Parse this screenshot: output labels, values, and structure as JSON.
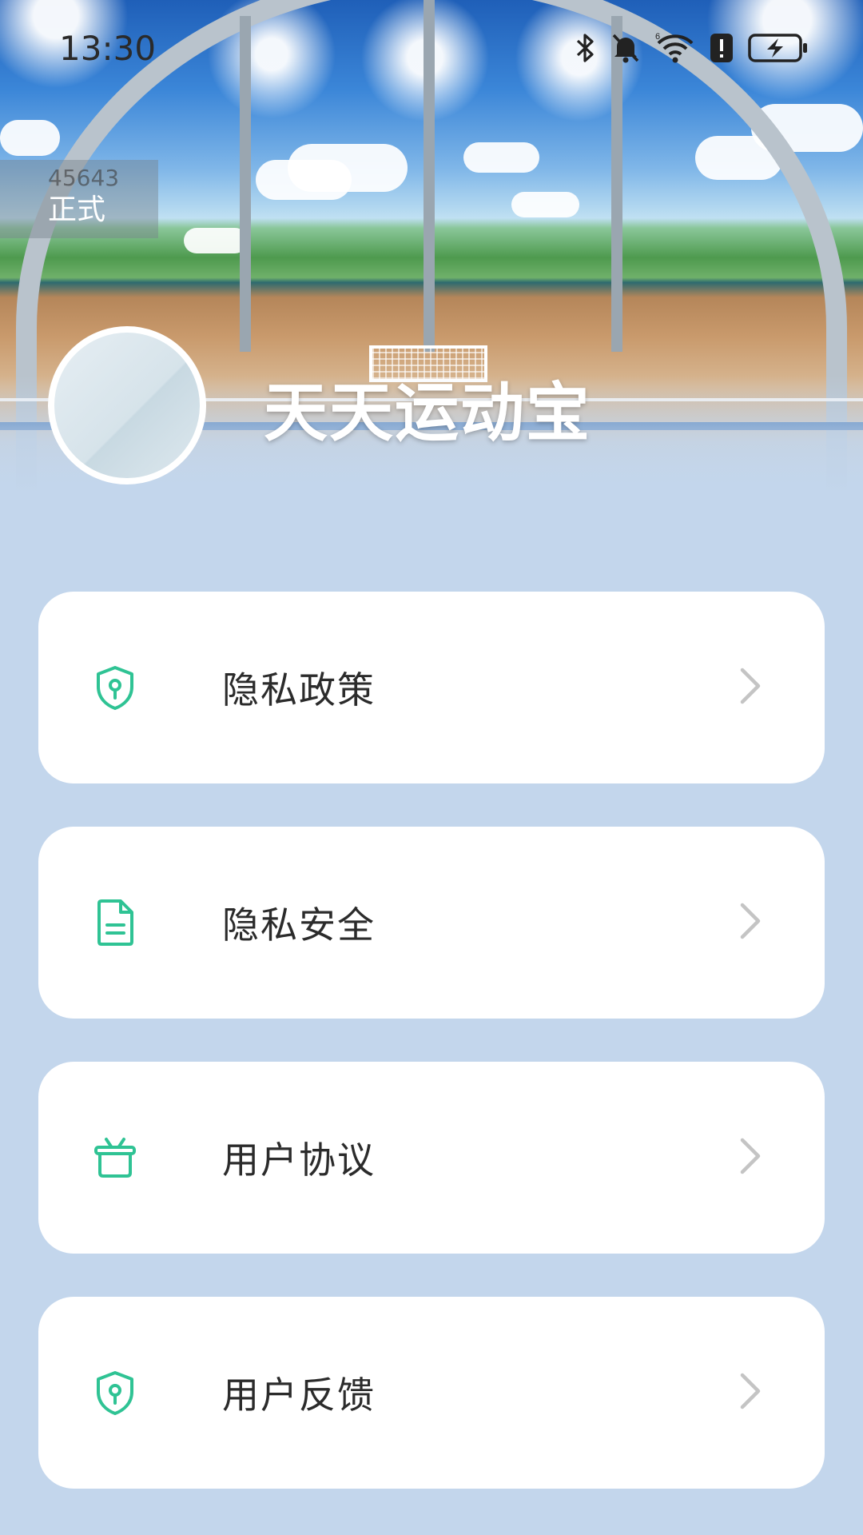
{
  "status_bar": {
    "time": "13:30",
    "icons": [
      "bluetooth-icon",
      "bell-muted-icon",
      "wifi-icon",
      "alert-icon",
      "battery-charging-icon"
    ]
  },
  "build_badge": {
    "id": "45643",
    "type": "正式"
  },
  "profile": {
    "app_name": "天天运动宝"
  },
  "menu": {
    "items": [
      {
        "label": "隐私政策",
        "icon": "shield-icon"
      },
      {
        "label": "隐私安全",
        "icon": "document-icon"
      },
      {
        "label": "用户协议",
        "icon": "basket-icon"
      },
      {
        "label": "用户反馈",
        "icon": "shield-icon"
      }
    ]
  },
  "colors": {
    "accent": "#2fc394",
    "page_background": "#c3d6ec",
    "card_background": "#ffffff",
    "chevron": "#c4c4c4"
  }
}
